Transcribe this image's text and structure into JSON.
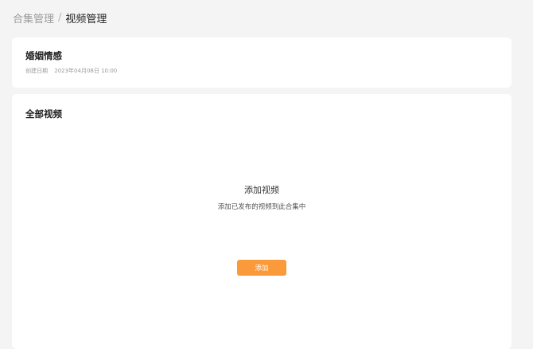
{
  "breadcrumb": {
    "parent": "合集管理",
    "separator": "/",
    "current": "视频管理"
  },
  "collection": {
    "name": "婚姻情感",
    "created_label": "创建日期",
    "created_value": "2023年04月08日 10:00"
  },
  "videos": {
    "section_title": "全部视频",
    "empty_title": "添加视频",
    "empty_description": "添加已发布的视频到此合集中",
    "add_button_label": "添加"
  },
  "colors": {
    "page_background": "#f4f4f4",
    "card_background": "#ffffff",
    "accent": "#fb9a3a"
  }
}
